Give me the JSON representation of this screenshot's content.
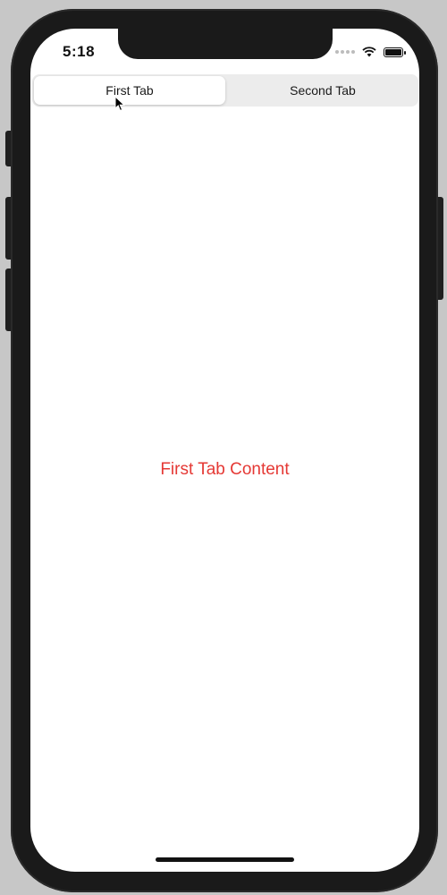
{
  "status_bar": {
    "time": "5:18",
    "battery_level": 1.0,
    "icons": [
      "signal-dots-icon",
      "wifi-icon",
      "battery-icon"
    ]
  },
  "segmented_control": {
    "segments": [
      {
        "label": "First Tab",
        "selected": true
      },
      {
        "label": "Second Tab",
        "selected": false
      }
    ]
  },
  "content": {
    "text": "First Tab Content",
    "text_color": "#e53935"
  }
}
